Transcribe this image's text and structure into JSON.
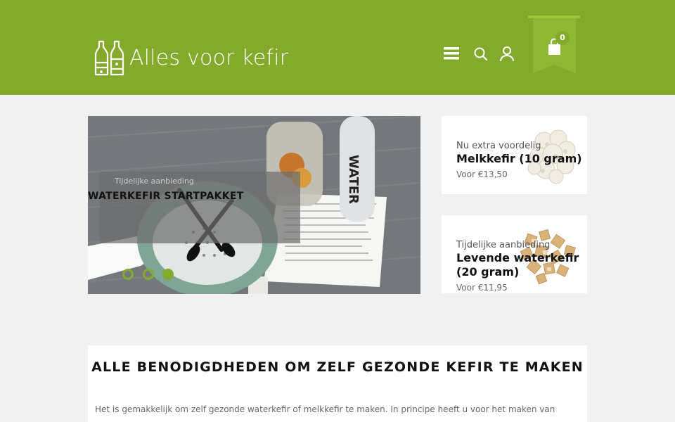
{
  "header": {
    "logo_text": "Alles voor kefir",
    "cart_count": "0",
    "brand_color": "#84aa2c"
  },
  "slider": {
    "kicker": "Tijdelijke aanbieding",
    "title": "WATERKEFIR STARTPAKKET",
    "dots": 3,
    "active_dot": 3
  },
  "promos": [
    {
      "kicker": "Nu extra voordelig",
      "title": "Melkkefir (10 gram)",
      "price": "Voor €13,50"
    },
    {
      "kicker": "Tijdelijke aanbieding",
      "title_line1": "Levende waterkefir",
      "title_line2": "(20 gram)",
      "price": "Voor €11,95"
    }
  ],
  "content": {
    "title": "ALLE BENODIGDHEDEN OM ZELF GEZONDE KEFIR TE MAKEN",
    "text": "Het is gemakkelijk om zelf gezonde waterkefir of melkkefir te maken. In principe heeft u voor het maken van"
  }
}
